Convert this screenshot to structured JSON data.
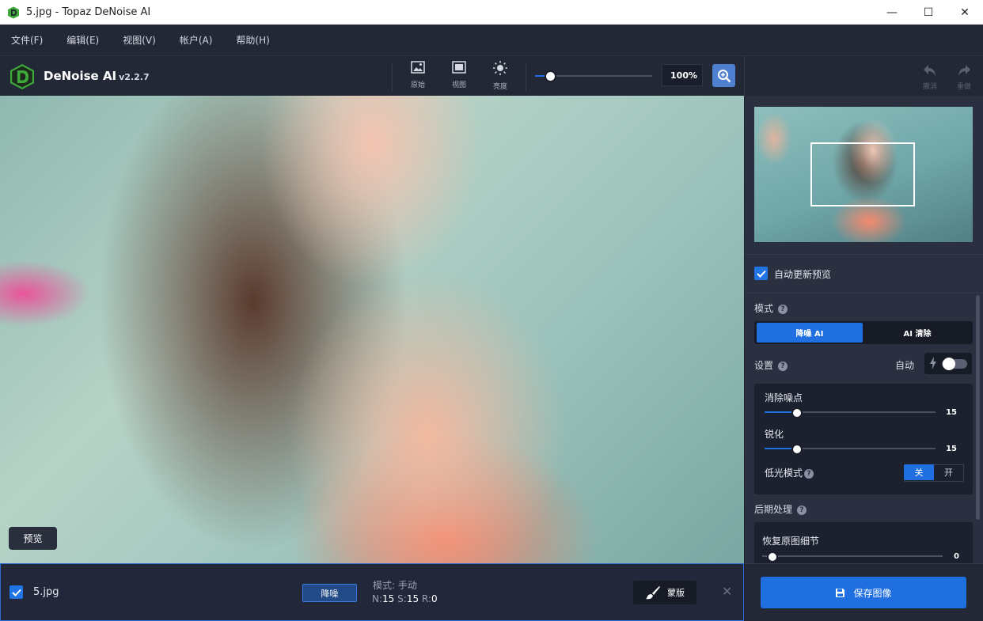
{
  "window": {
    "title": "5.jpg - Topaz DeNoise AI",
    "minimize": "—",
    "maximize": "☐",
    "close": "✕"
  },
  "menu": [
    {
      "label": "文件(F)"
    },
    {
      "label": "编辑(E)"
    },
    {
      "label": "视图(V)"
    },
    {
      "label": "帐户(A)"
    },
    {
      "label": "帮助(H)"
    }
  ],
  "toolbar": {
    "app_name": "DeNoise AI",
    "app_version": "v2.2.7",
    "buttons": [
      {
        "label": "原始",
        "icon": "image-icon"
      },
      {
        "label": "视图",
        "icon": "view-icon"
      },
      {
        "label": "亮度",
        "icon": "brightness-icon"
      }
    ],
    "zoom_value": "100%",
    "zoom_level": 0.08,
    "undo_label": "撤消",
    "redo_label": "重做"
  },
  "canvas": {
    "preview_button": "预览"
  },
  "file_panel": {
    "checked": true,
    "filename": "5.jpg",
    "tag": "降噪",
    "mode_text": "模式: 手动",
    "stats": {
      "n_label": "N:",
      "n_value": "15",
      "s_label": "S:",
      "s_value": "15",
      "r_label": "R:",
      "r_value": "0"
    },
    "mask_button": "蒙版",
    "close": "✕"
  },
  "right_panel": {
    "auto_update_label": "自动更新预览",
    "auto_update_checked": true,
    "mode_label": "模式",
    "mode_options": [
      {
        "label": "降噪 AI",
        "selected": true
      },
      {
        "label": "AI 清除",
        "selected": false
      }
    ],
    "settings_label": "设置",
    "auto_label": "自动",
    "auto_toggle_on": false,
    "sliders": [
      {
        "label": "消除噪点",
        "value": "15",
        "fraction": 0.19
      },
      {
        "label": "锐化",
        "value": "15",
        "fraction": 0.19
      }
    ],
    "low_light_label": "低光模式",
    "low_light_off": "关",
    "low_light_on": "开",
    "post_label": "后期处理",
    "recover_label": "恢复原图细节",
    "recover_value": "0",
    "recover_fraction": 0.0,
    "save_button": "保存图像"
  },
  "colors": {
    "accent": "#1f6fe0",
    "panel": "#2a3040",
    "bar": "#232837",
    "logo": "#3fa83a"
  }
}
